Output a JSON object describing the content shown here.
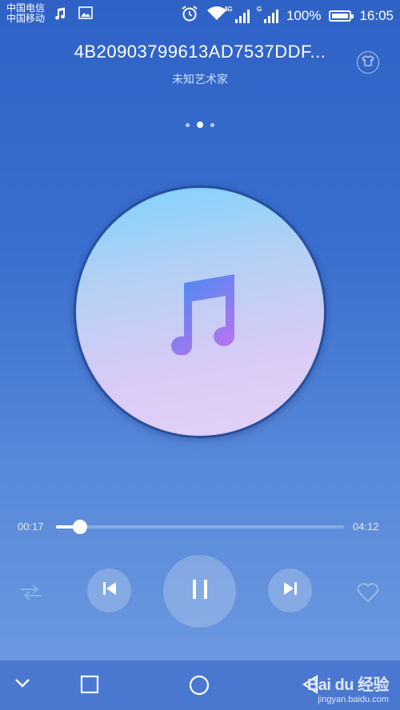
{
  "status_bar": {
    "carrier_1": "中国电信",
    "carrier_2": "中国移动",
    "signal_1_tag": "4G",
    "signal_2_tag": "G",
    "battery": "100%",
    "time": "16:05"
  },
  "player": {
    "title": "4B20903799613AD7537DDF...",
    "artist": "未知艺术家",
    "pager": {
      "pages": 3,
      "active_index": 1
    },
    "elapsed": "00:17",
    "duration": "04:12",
    "progress_fraction": 0.082
  },
  "watermark": {
    "brand": "Bai du 经验",
    "url": "jingyan.baidu.com"
  },
  "icons": {
    "status": [
      "music-note-icon",
      "image-icon",
      "alarm-icon",
      "wifi-icon",
      "signal-icon",
      "battery-icon"
    ],
    "controls": [
      "shuffle-icon",
      "previous-icon",
      "pause-icon",
      "next-icon",
      "heart-icon"
    ],
    "nav": [
      "chevron-down-icon",
      "recent-apps-icon",
      "home-icon",
      "back-icon"
    ]
  },
  "colors": {
    "background_top": "#2f62c6",
    "background_bottom": "#6f9ae0",
    "disc_border": "#264f9e",
    "note_gradient_start": "#3e8ef0",
    "note_gradient_end": "#b174f0"
  }
}
